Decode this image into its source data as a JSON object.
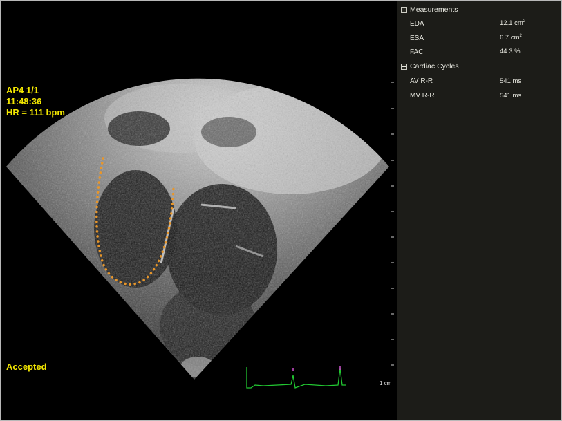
{
  "overlay": {
    "view": "AP4  1/1",
    "time": "11:48:36",
    "heart_rate": "HR = 111 bpm",
    "status": "Accepted"
  },
  "scale": {
    "label": "1 cm"
  },
  "measurements": {
    "title": "Measurements",
    "rows": [
      {
        "label": "EDA",
        "value": "12.1 cm",
        "unit_sup": "2"
      },
      {
        "label": "ESA",
        "value": "6.7 cm",
        "unit_sup": "2"
      },
      {
        "label": "FAC",
        "value": "44.3 %",
        "unit_sup": ""
      }
    ]
  },
  "cardiac_cycles": {
    "title": "Cardiac Cycles",
    "rows": [
      {
        "label": "AV R-R",
        "value": "541 ms"
      },
      {
        "label": "MV R-R",
        "value": "541 ms"
      }
    ]
  },
  "colors": {
    "overlay_text": "#f2e600",
    "trace": "#e8962a",
    "ecg": "#22c832",
    "panel_bg": "#1c1c18"
  }
}
